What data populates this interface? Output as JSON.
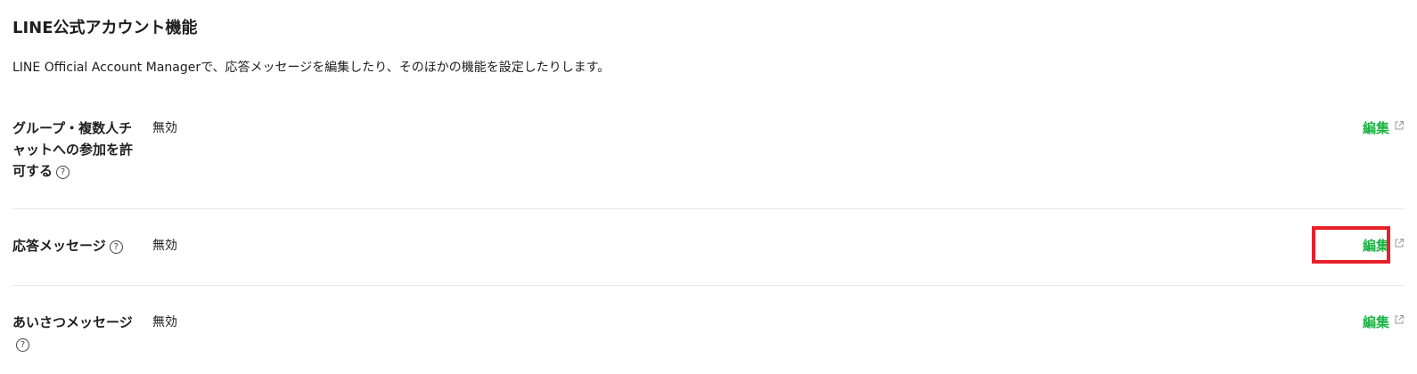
{
  "section": {
    "title": "LINE公式アカウント機能",
    "description": "LINE Official Account Managerで、応答メッセージを編集したり、そのほかの機能を設定したりします。"
  },
  "rows": [
    {
      "label": "グループ・複数人チャットへの参加を許可する",
      "value": "無効",
      "edit_label": "編集",
      "has_help": true
    },
    {
      "label": "応答メッセージ",
      "value": "無効",
      "edit_label": "編集",
      "has_help": true
    },
    {
      "label": "あいさつメッセージ",
      "value": "無効",
      "edit_label": "編集",
      "has_help": true
    }
  ],
  "icons": {
    "help": "help-icon",
    "external": "external-link-icon",
    "help_glyph": "?"
  },
  "colors": {
    "link": "#1db446",
    "highlight": "#e8202a",
    "divider": "#e8e8e8"
  }
}
